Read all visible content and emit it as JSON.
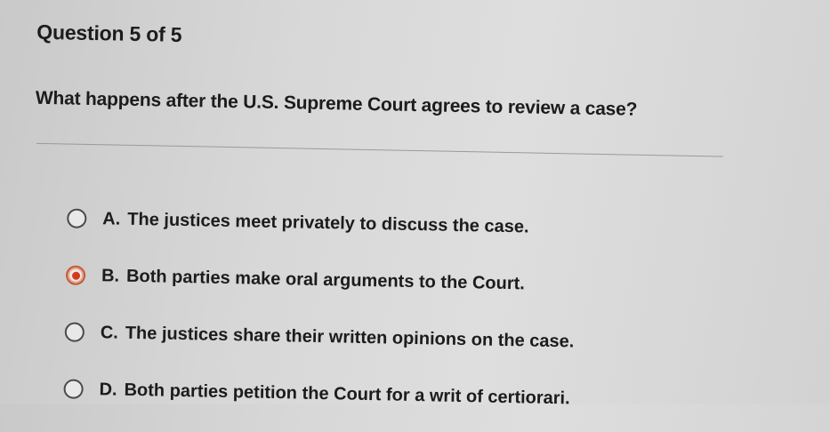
{
  "quiz": {
    "progress_label": "Question 5 of 5",
    "question": "What happens after the U.S. Supreme Court agrees to review a case?",
    "selected_option": "B",
    "options": [
      {
        "letter": "A.",
        "text": "The justices meet privately to discuss the case."
      },
      {
        "letter": "B.",
        "text": "Both parties make oral arguments to the Court."
      },
      {
        "letter": "C.",
        "text": "The justices share their written opinions on the case."
      },
      {
        "letter": "D.",
        "text": "Both parties petition the Court for a writ of certiorari."
      }
    ]
  },
  "colors": {
    "selected_radio": "#d23a1e",
    "text": "#1c1c1c"
  }
}
